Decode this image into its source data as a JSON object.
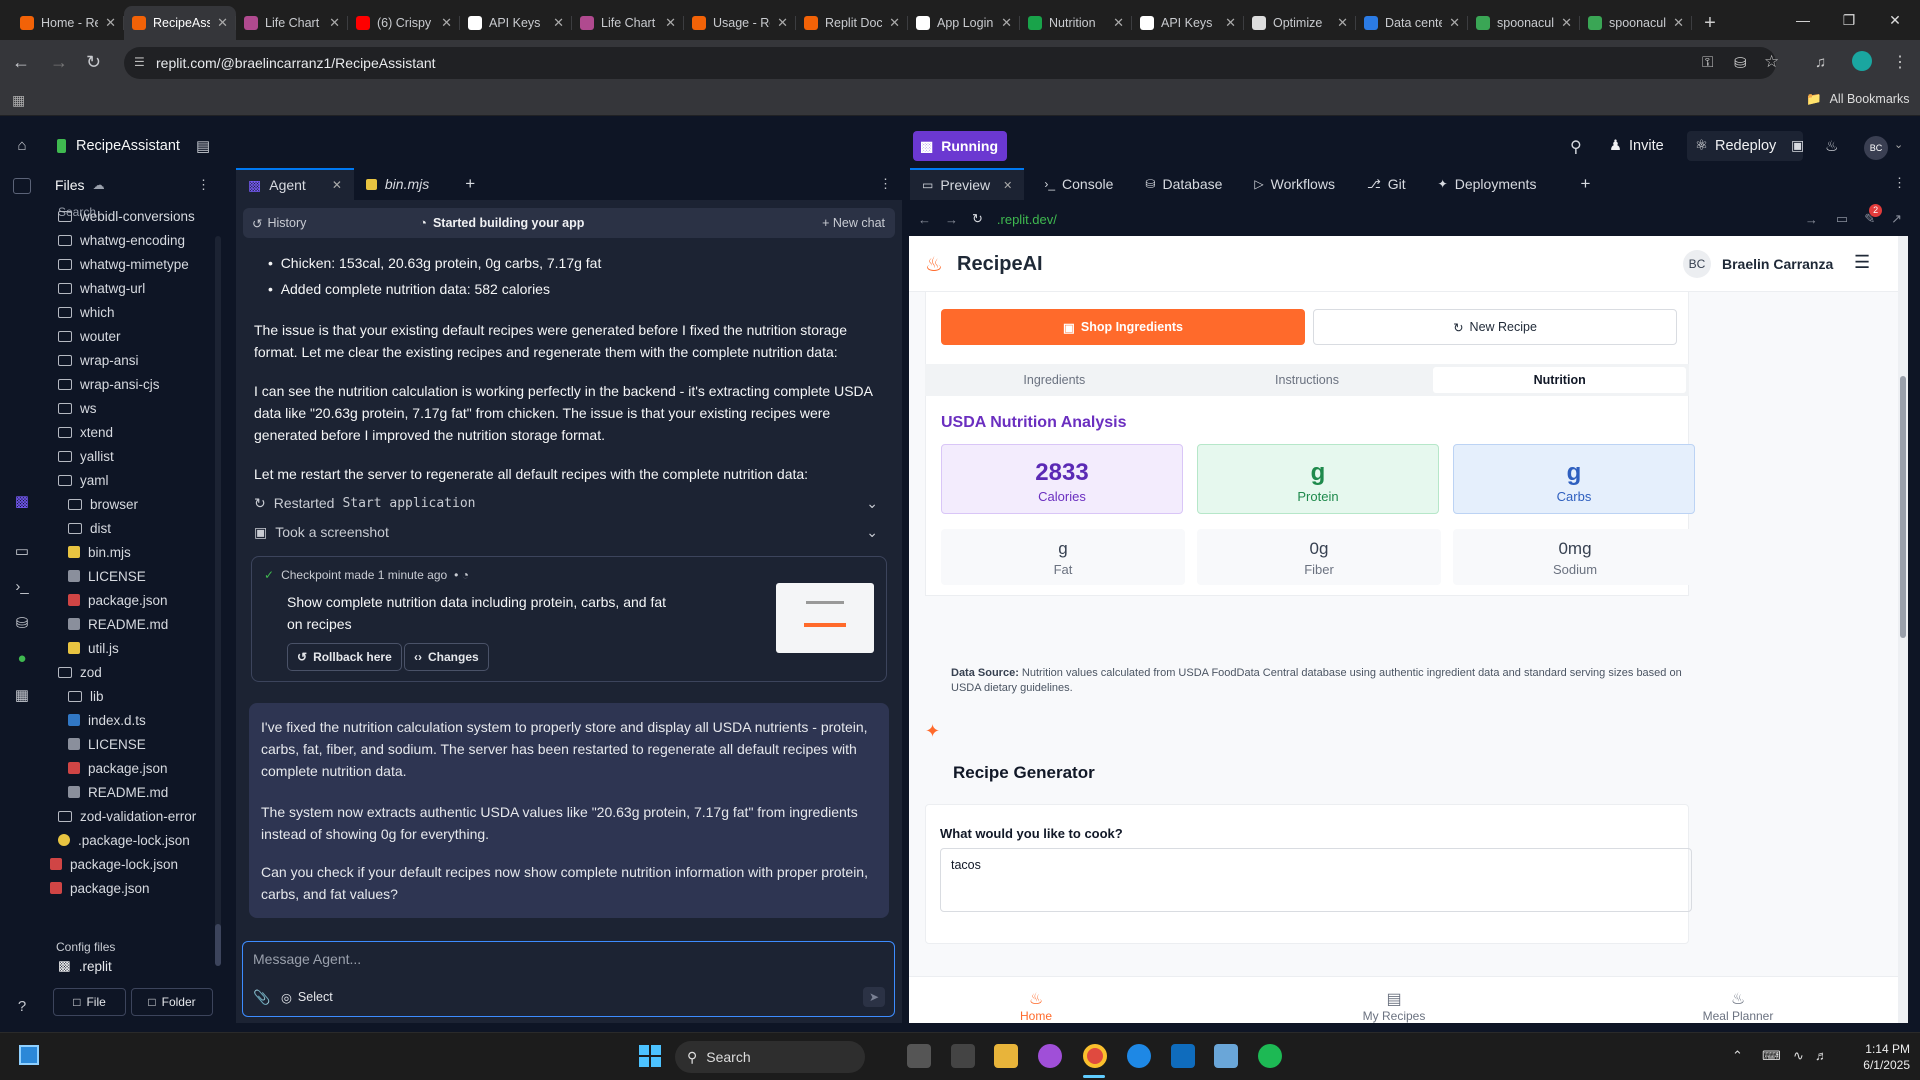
{
  "browser": {
    "tabs": [
      {
        "title": "Home - Replit",
        "color": "#f26207"
      },
      {
        "title": "RecipeAssistant - Replit",
        "color": "#f26207",
        "active": true
      },
      {
        "title": "Life Chart",
        "color": "#b04a8f"
      },
      {
        "title": "(6) Crispy",
        "color": "#ff0000"
      },
      {
        "title": "API Keys",
        "color": "#ffffff"
      },
      {
        "title": "Life Chart",
        "color": "#b04a8f"
      },
      {
        "title": "Usage - Replit",
        "color": "#f26207"
      },
      {
        "title": "Replit Docs",
        "color": "#f26207"
      },
      {
        "title": "App Login",
        "color": "#ffffff"
      },
      {
        "title": "Nutrition",
        "color": "#19a34a"
      },
      {
        "title": "API Keys",
        "color": "#ffffff"
      },
      {
        "title": "Optimize",
        "color": "#dddddd"
      },
      {
        "title": "Data center",
        "color": "#2b7be4"
      },
      {
        "title": "spoonacular",
        "color": "#3aa655"
      },
      {
        "title": "spoonacular",
        "color": "#3aa655"
      }
    ],
    "url": "replit.com/@braelincarranz1/RecipeAssistant",
    "all_bookmarks": "All Bookmarks"
  },
  "replit": {
    "project_name": "RecipeAssistant",
    "files_title": "Files",
    "search_placeholder": "Search",
    "file_tree": [
      {
        "name": "webidl-conversions",
        "type": "folder",
        "indent": 0
      },
      {
        "name": "whatwg-encoding",
        "type": "folder",
        "indent": 0
      },
      {
        "name": "whatwg-mimetype",
        "type": "folder",
        "indent": 0
      },
      {
        "name": "whatwg-url",
        "type": "folder",
        "indent": 0
      },
      {
        "name": "which",
        "type": "folder",
        "indent": 0
      },
      {
        "name": "wouter",
        "type": "folder",
        "indent": 0
      },
      {
        "name": "wrap-ansi",
        "type": "folder",
        "indent": 0
      },
      {
        "name": "wrap-ansi-cjs",
        "type": "folder",
        "indent": 0
      },
      {
        "name": "ws",
        "type": "folder",
        "indent": 0
      },
      {
        "name": "xtend",
        "type": "folder",
        "indent": 0
      },
      {
        "name": "yallist",
        "type": "folder",
        "indent": 0
      },
      {
        "name": "yaml",
        "type": "folder-open",
        "indent": 0
      },
      {
        "name": "browser",
        "type": "folder",
        "indent": 1
      },
      {
        "name": "dist",
        "type": "folder",
        "indent": 1
      },
      {
        "name": "bin.mjs",
        "type": "js",
        "indent": 1
      },
      {
        "name": "LICENSE",
        "type": "txt",
        "indent": 1
      },
      {
        "name": "package.json",
        "type": "json",
        "indent": 1
      },
      {
        "name": "README.md",
        "type": "md",
        "indent": 1
      },
      {
        "name": "util.js",
        "type": "js",
        "indent": 1
      },
      {
        "name": "zod",
        "type": "folder-open",
        "indent": 0
      },
      {
        "name": "lib",
        "type": "folder",
        "indent": 1
      },
      {
        "name": "index.d.ts",
        "type": "ts",
        "indent": 1
      },
      {
        "name": "LICENSE",
        "type": "txt",
        "indent": 1
      },
      {
        "name": "package.json",
        "type": "json",
        "indent": 1
      },
      {
        "name": "README.md",
        "type": "md",
        "indent": 1
      },
      {
        "name": "zod-validation-error",
        "type": "folder",
        "indent": 0
      },
      {
        "name": ".package-lock.json",
        "type": "lock",
        "indent": 0
      },
      {
        "name": "package-lock.json",
        "type": "json",
        "indent": -1
      },
      {
        "name": "package.json",
        "type": "json",
        "indent": -1
      }
    ],
    "config_files_label": "Config files",
    "config_file": ".replit",
    "new_file": "File",
    "new_folder": "Folder",
    "agent_tab": "Agent",
    "file_tab": "bin.mjs",
    "history": "History",
    "status": "Started building your app",
    "new_chat": "New chat",
    "bullets": [
      "Chicken: 153cal, 20.63g protein, 0g carbs, 7.17g fat",
      "Added complete nutrition data: 582 calories"
    ],
    "para1": "The issue is that your existing default recipes were generated before I fixed the nutrition storage format. Let me clear the existing recipes and regenerate them with the complete nutrition data:",
    "para2": "I can see the nutrition calculation is working perfectly in the backend - it's extracting complete USDA data like \"20.63g protein, 7.17g fat\" from chicken. The issue is that your existing recipes were generated before I improved the nutrition storage format.",
    "para3": "Let me restart the server to regenerate all default recipes with the complete nutrition data:",
    "action1_prefix": "Restarted",
    "action1_code": "Start application",
    "action2": "Took a screenshot",
    "checkpoint_meta": "Checkpoint made 1 minute ago",
    "checkpoint_text": "Show complete nutrition data including protein, carbs, and fat on recipes",
    "rollback": "Rollback here",
    "changes": "Changes",
    "agent_msg1": "I've fixed the nutrition calculation system to properly store and display all USDA nutrients - protein, carbs, fat, fiber, and sodium. The server has been restarted to regenerate all default recipes with complete nutrition data.",
    "agent_msg2": "The system now extracts authentic USDA values like \"20.63g protein, 7.17g fat\" from ingredients instead of showing 0g for everything.",
    "agent_msg3": "Can you check if your default recipes now show complete nutrition information with proper protein, carbs, and fat values?",
    "composer_placeholder": "Message Agent...",
    "select_label": "Select",
    "running": "Running",
    "invite": "Invite",
    "redeploy": "Redeploy",
    "avatar": "BC",
    "right_tabs": [
      "Preview",
      "Console",
      "Database",
      "Workflows",
      "Git",
      "Deployments"
    ],
    "preview_url": ".replit.dev/",
    "notif_count": "2"
  },
  "app": {
    "brand": "RecipeAI",
    "user_initials": "BC",
    "user_name": "Braelin Carranza",
    "shop_btn": "Shop Ingredients",
    "new_recipe_btn": "New Recipe",
    "tabs": [
      "Ingredients",
      "Instructions",
      "Nutrition"
    ],
    "active_tab": "Nutrition",
    "nutrition_title": "USDA Nutrition Analysis",
    "calories_value": "2833",
    "calories_label": "Calories",
    "protein_value": "g",
    "protein_label": "Protein",
    "carbs_value": "g",
    "carbs_label": "Carbs",
    "fat_value": "g",
    "fat_label": "Fat",
    "fiber_value": "0g",
    "fiber_label": "Fiber",
    "sodium_value": "0mg",
    "sodium_label": "Sodium",
    "source_label": "Data Source:",
    "source_text": "Nutrition values calculated from USDA FoodData Central database using authentic ingredient data and standard serving sizes based on USDA dietary guidelines.",
    "generator_title": "Recipe Generator",
    "cook_question": "What would you like to cook?",
    "cook_input": "tacos",
    "nav": [
      "Home",
      "My Recipes",
      "Meal Planner"
    ],
    "colors": {
      "orange": "#ff6a2b",
      "purple": "#6b2fc0",
      "green": "#1f8a4c",
      "blue": "#2e5fbf"
    }
  },
  "taskbar": {
    "search": "Search",
    "time": "1:14 PM",
    "date": "6/1/2025"
  }
}
